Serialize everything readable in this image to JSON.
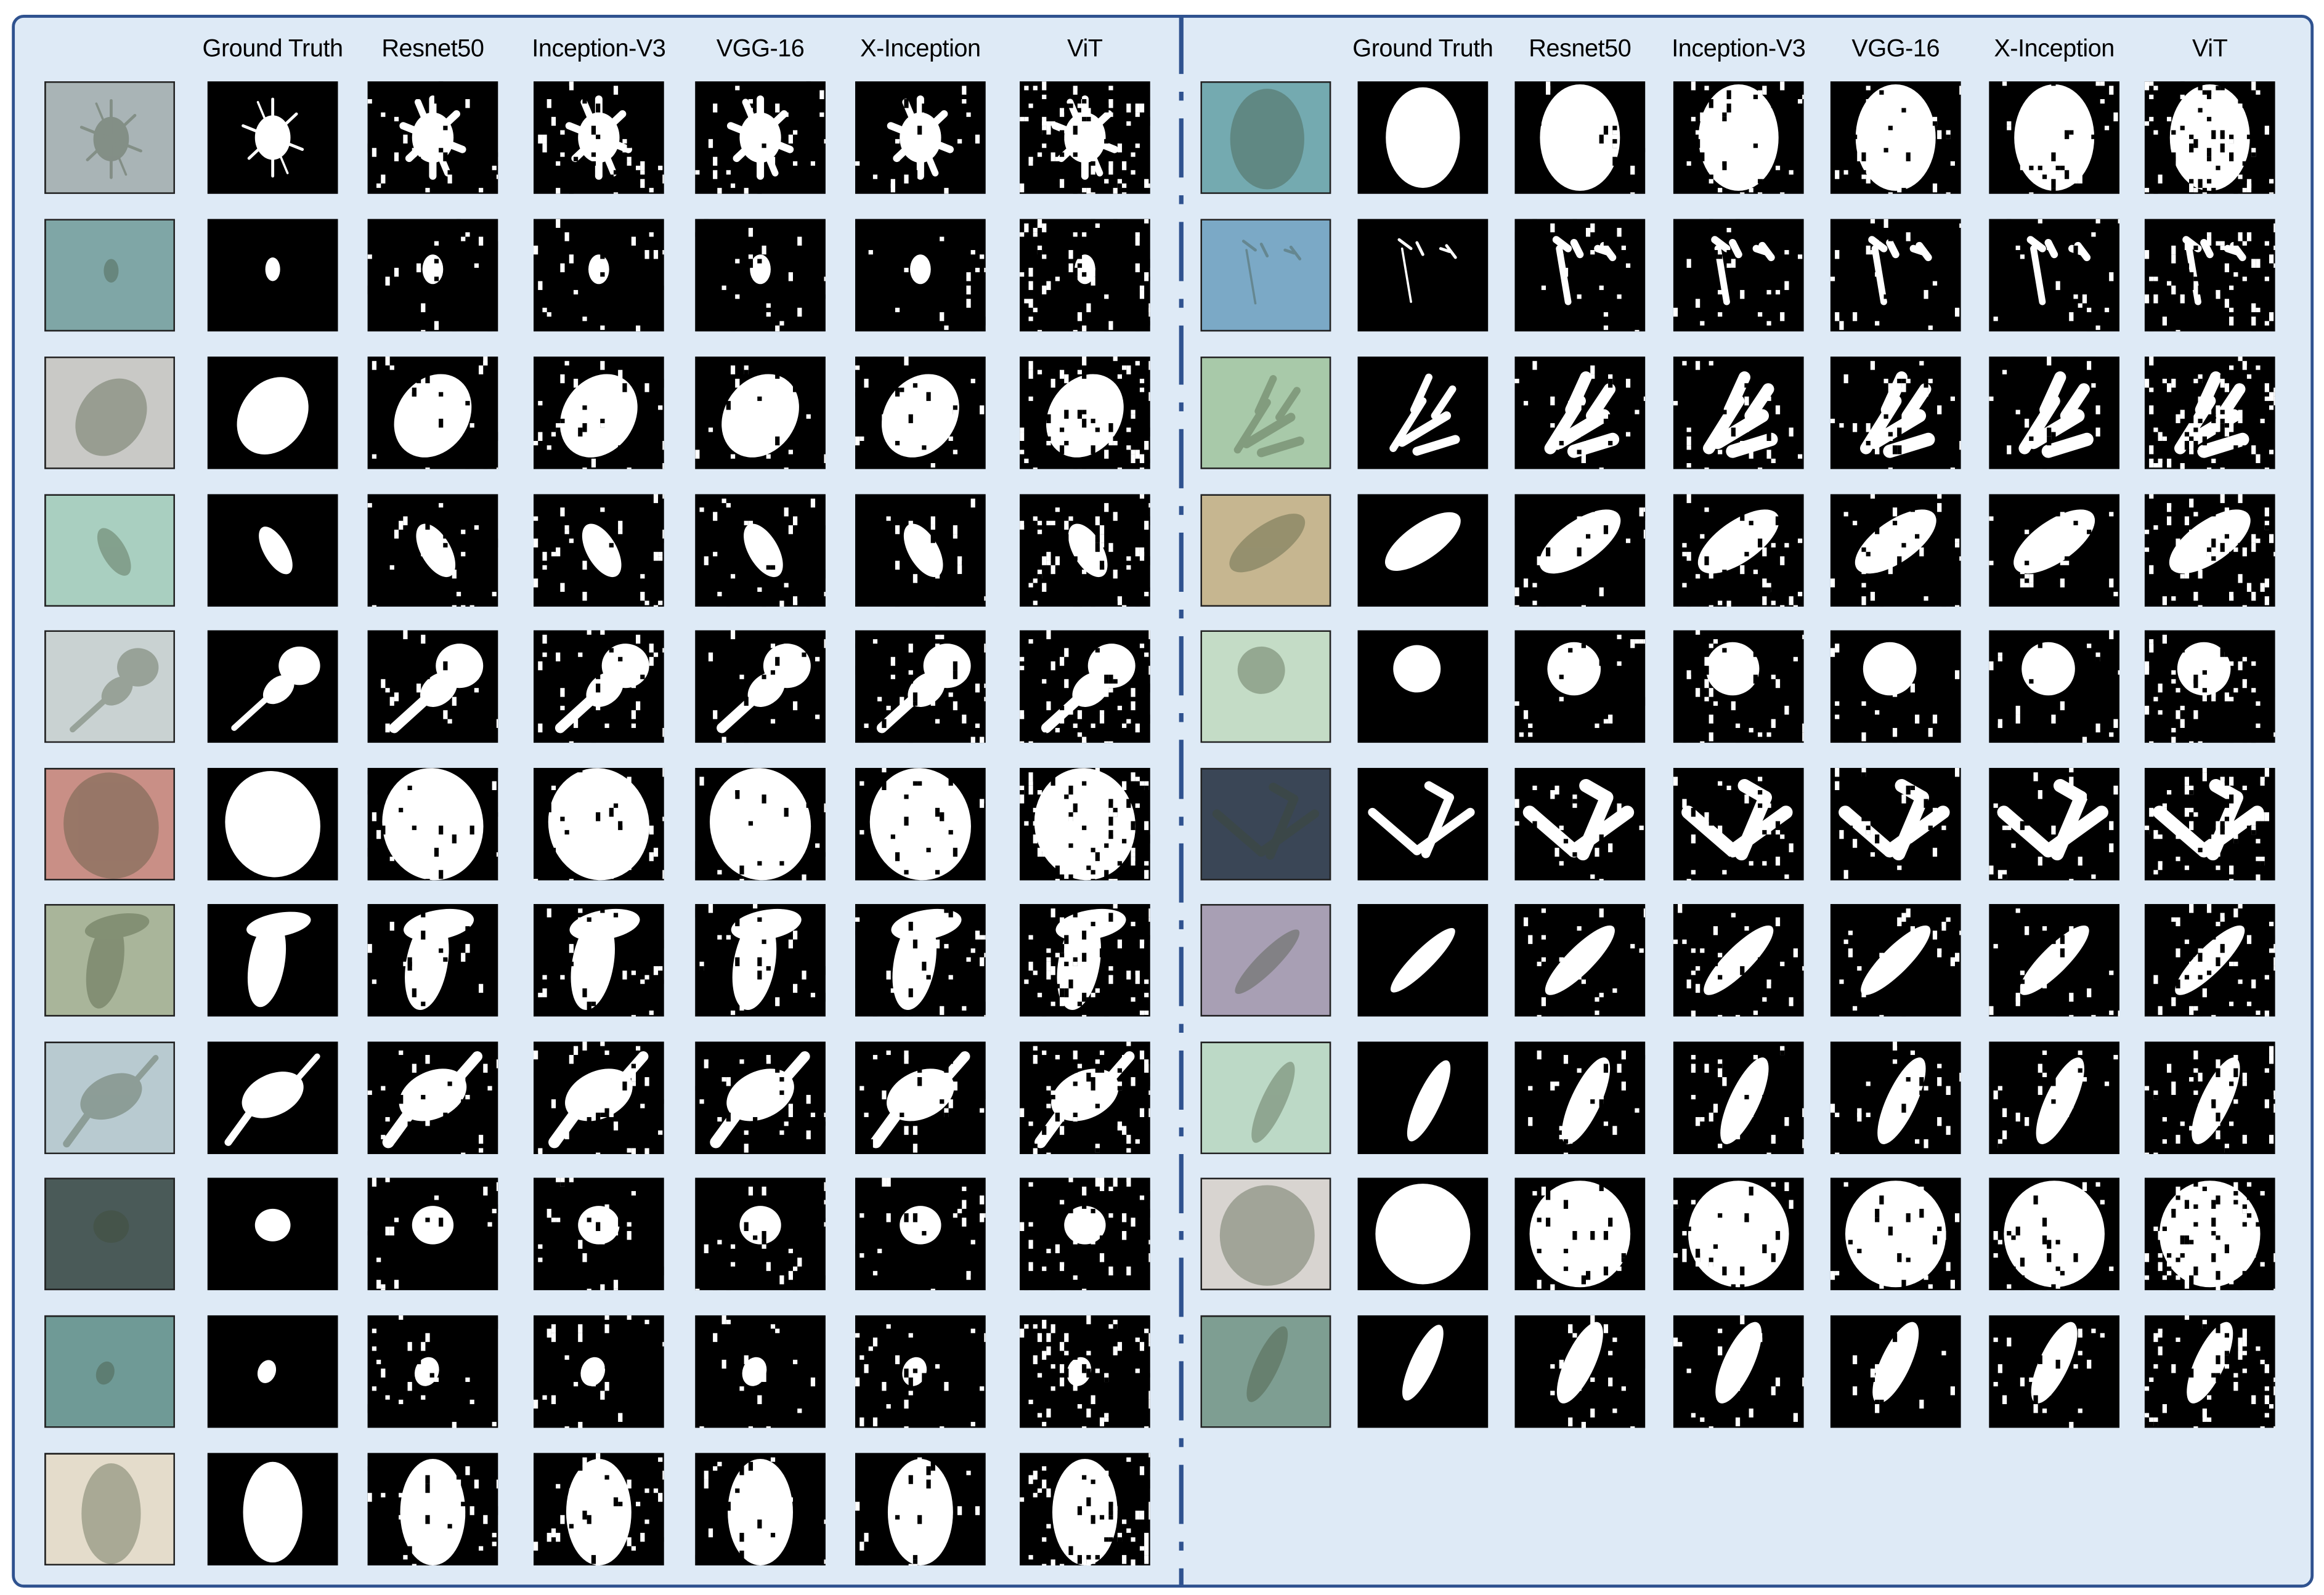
{
  "figure": {
    "panels": [
      {
        "name": "left",
        "headers": [
          "Ground Truth",
          "Resnet50",
          "Inception-V3",
          "VGG-16",
          "X-Inception",
          "ViT"
        ],
        "input_colors": [
          "#a9b4b6",
          "#7fa6a6",
          "#c9c9c6",
          "#a9cfc0",
          "#c9d2d2",
          "#c98f86",
          "#a9b59a",
          "#b8cad0",
          "#4a5a58",
          "#6f9a96",
          "#e4dccb"
        ]
      },
      {
        "name": "right",
        "headers": [
          "Ground Truth",
          "Resnet50",
          "Inception-V3",
          "VGG-16",
          "X-Inception",
          "ViT"
        ],
        "input_colors": [
          "#74aab0",
          "#7ba9c6",
          "#a8c9a9",
          "#c6b690",
          "#c4dcc6",
          "#3a4656",
          "#a89fb4",
          "#bcd9c6",
          "#d8d4d0",
          "#7e9e92"
        ]
      }
    ]
  },
  "colors": {
    "frame_border": "#2F528F",
    "frame_fill": "#DEEAF6",
    "mask_fg": "#FFFFFF",
    "mask_bg": "#000000"
  }
}
